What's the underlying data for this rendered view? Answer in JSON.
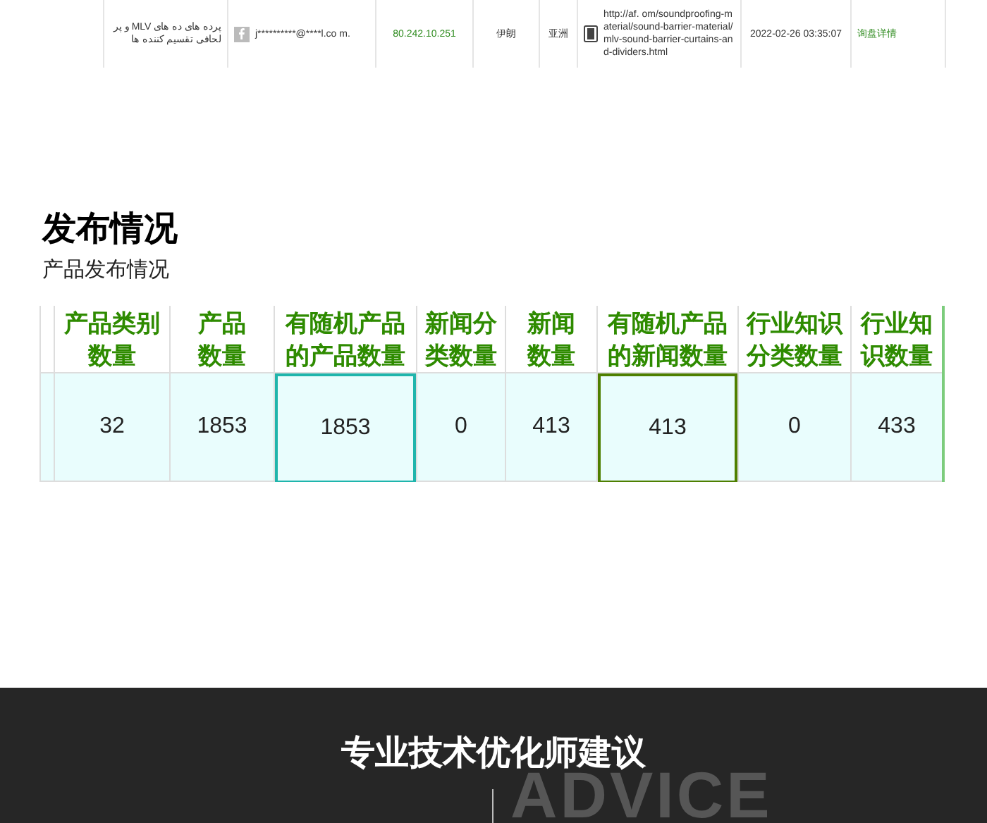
{
  "inquiry_row": {
    "message": "و پر MLV پرده های ده های لحافی تقسیم کننده ها",
    "email": "j**********@****l.co m.",
    "ip": "80.242.10.251",
    "country": "伊朗",
    "region": "亚洲",
    "url": "http://af. om/soundproofing-material/sound-barrier-material/mlv-sound-barrier-curtains-and-dividers.html",
    "time": "2022-02-26 03:35:07",
    "action": "询盘详情"
  },
  "section": {
    "title": "发布情况",
    "subtitle": "产品发布情况"
  },
  "table": {
    "columns": [
      {
        "selected": false
      },
      {
        "header": "产品类别数量",
        "value": "32",
        "selected": false
      },
      {
        "header": "产品数量",
        "value": "1853",
        "selected": false
      },
      {
        "header": "有随机产品的产品数量",
        "value": "1853",
        "selected": true,
        "color": "#1fb5ac"
      },
      {
        "header": "新闻分类数量",
        "value": "0",
        "selected": false
      },
      {
        "header": "新闻数量",
        "value": "413",
        "selected": false
      },
      {
        "header": "有随机产品的新闻数量",
        "value": "413",
        "selected": true,
        "color": "#4e7f00"
      },
      {
        "header": "行业知识分类数量",
        "value": "0",
        "selected": false
      },
      {
        "header": "行业知识数量",
        "value": "433",
        "selected": false
      }
    ]
  },
  "footer": {
    "title": "专业技术优化师建议",
    "watermark": "ADVICE"
  }
}
